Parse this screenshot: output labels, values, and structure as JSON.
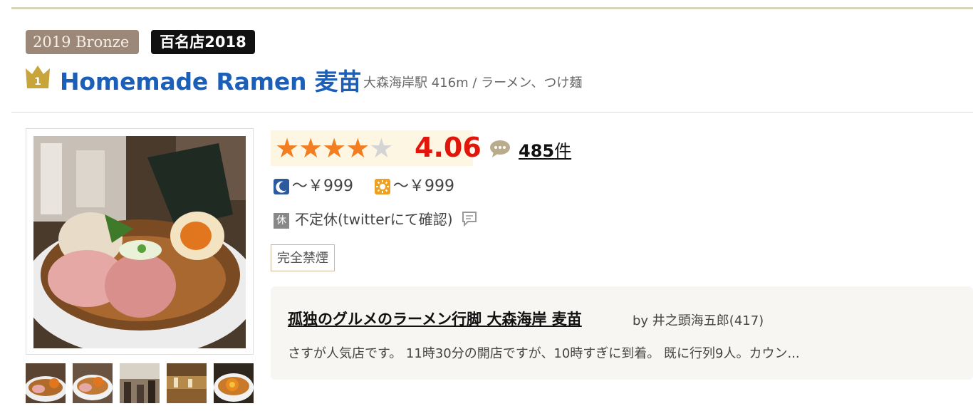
{
  "award": {
    "bronze_label": "2019 Bronze",
    "hyakumeiten_label": "百名店2018"
  },
  "restaurant": {
    "rank_number": "1",
    "name": "Homemade Ramen 麦苗",
    "area": "大森海岸駅 416m / ラーメン、つけ麺"
  },
  "rating": {
    "score": "4.06",
    "stars_filled": 4,
    "stars_total": 5,
    "star_glyph": "★"
  },
  "reviews": {
    "count": "485",
    "suffix": "件"
  },
  "price": {
    "dinner": "～￥999",
    "lunch": "～￥999"
  },
  "holiday": {
    "icon_label": "休",
    "text": "不定休(twitterにて確認)"
  },
  "tags": {
    "smoking": "完全禁煙"
  },
  "featured_review": {
    "title": "孤独のグルメのラーメン行脚 大森海岸 麦苗",
    "by": "by 井之頭海五郎(417)",
    "excerpt": "さすが人気店です。 11時30分の開店ですが、10時すぎに到着。 既に行列9人。カウン..."
  },
  "colors": {
    "title_blue": "#1b5fb8",
    "score_red": "#e2150b",
    "star_orange": "#f27e21"
  }
}
